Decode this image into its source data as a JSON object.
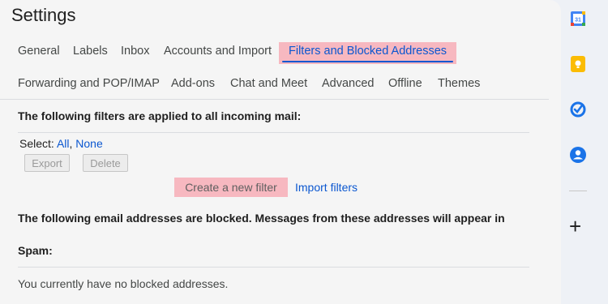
{
  "page": {
    "title": "Settings"
  },
  "tabs": [
    {
      "label": "General"
    },
    {
      "label": "Labels"
    },
    {
      "label": "Inbox"
    },
    {
      "label": "Accounts and Import"
    },
    {
      "label": "Filters and Blocked Addresses",
      "active": true
    },
    {
      "label": "Forwarding and POP/IMAP"
    },
    {
      "label": "Add-ons"
    },
    {
      "label": "Chat and Meet"
    },
    {
      "label": "Advanced"
    },
    {
      "label": "Offline"
    },
    {
      "label": "Themes"
    }
  ],
  "filters": {
    "heading": "The following filters are applied to all incoming mail:",
    "select_label": "Select:",
    "select_all": "All",
    "select_separator": ",",
    "select_none": "None",
    "export_label": "Export",
    "delete_label": "Delete",
    "create_label": "Create a new filter",
    "import_label": "Import filters"
  },
  "blocked": {
    "heading_line1": "The following email addresses are blocked. Messages from these addresses will appear in",
    "heading_line2": "Spam:",
    "empty_message": "You currently have no blocked addresses."
  },
  "side_panel": {
    "icons": [
      "calendar-icon",
      "keep-icon",
      "tasks-icon",
      "contacts-icon",
      "add-icon"
    ],
    "calendar_day": "31",
    "add_label": "+"
  },
  "colors": {
    "accent": "#0b57d0",
    "highlight": "#f7b8c0",
    "background": "#f5f5f5"
  }
}
